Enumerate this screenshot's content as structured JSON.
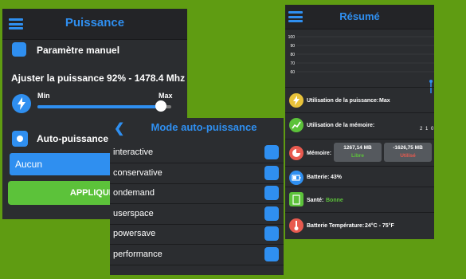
{
  "colors": {
    "accent": "#2f8ff0",
    "background": "#5f9c12",
    "panel": "#2b2d30",
    "apply": "#5cc23a",
    "good": "#5cc23a",
    "bad": "#e85a4f"
  },
  "left": {
    "title": "Puissance",
    "manual_label": "Paramètre manuel",
    "adjust_label": "Ajuster la puissance  92% - 1478.4 Mhz",
    "min_label": "Min",
    "max_label": "Max",
    "slider_value_percent": 92,
    "auto_label": "Auto-puissance",
    "dropdown_value": "Aucun",
    "apply_label": "APPLIQUER"
  },
  "middle": {
    "title": "Mode auto-puissance",
    "back_icon": "chevron-left-icon",
    "governors": [
      "interactive",
      "conservative",
      "ondemand",
      "userspace",
      "powersave",
      "performance"
    ]
  },
  "right": {
    "title": "Résumé",
    "chart_data": {
      "type": "line",
      "y_ticks": [
        100,
        90,
        80,
        70,
        60
      ],
      "x_ticks": [
        "2",
        "1",
        "0"
      ],
      "grid": true
    },
    "power_label": "Utilisation de la puissance:",
    "power_value": "Max",
    "memory_label": "Utilisation de la mémoire:",
    "mem_label": "Mémoire:",
    "mem_free_value": "1267,14 MB",
    "mem_free_caption": "Libre",
    "mem_used_value": "-1626,75 MB",
    "mem_used_caption": "Utilisé",
    "battery_label": "Batterie:",
    "battery_value": "43%",
    "health_label": "Santé:",
    "health_value": "Bonne",
    "temp_label": "Batterie Température:",
    "temp_value": "24°C - 75°F"
  }
}
